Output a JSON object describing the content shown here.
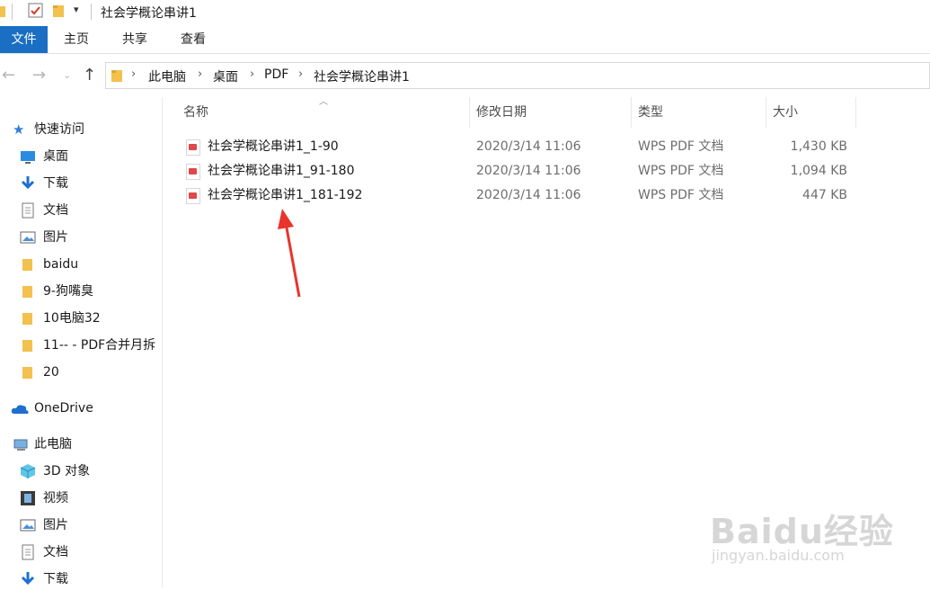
{
  "window": {
    "title": "社会学概论串讲1"
  },
  "ribbon": {
    "tabs": [
      "文件",
      "主页",
      "共享",
      "查看"
    ]
  },
  "address": {
    "crumbs": [
      "此电脑",
      "桌面",
      "PDF",
      "社会学概论串讲1"
    ]
  },
  "nav": {
    "quick_access": "快速访问",
    "quick_items": [
      "桌面",
      "下载",
      "文档",
      "图片",
      "baidu",
      "9-狗嘴臭",
      "10电脑32",
      "11-- - PDF合并月拆",
      "20"
    ],
    "onedrive": "OneDrive",
    "this_pc": "此电脑",
    "pc_items": [
      "3D 对象",
      "视频",
      "图片",
      "文档",
      "下载"
    ]
  },
  "columns": {
    "name": "名称",
    "modified": "修改日期",
    "type": "类型",
    "size": "大小"
  },
  "files": [
    {
      "name": "社会学概论串讲1_1-90",
      "modified": "2020/3/14 11:06",
      "type": "WPS PDF 文档",
      "size": "1,430 KB"
    },
    {
      "name": "社会学概论串讲1_91-180",
      "modified": "2020/3/14 11:06",
      "type": "WPS PDF 文档",
      "size": "1,094 KB"
    },
    {
      "name": "社会学概论串讲1_181-192",
      "modified": "2020/3/14 11:06",
      "type": "WPS PDF 文档",
      "size": "447 KB"
    }
  ],
  "watermark": {
    "brand": "Baidu经验",
    "url": "jingyan.baidu.com"
  },
  "colors": {
    "accent": "#1a6fc4",
    "arrow": "#e8342c",
    "folder": "#f2c14e"
  }
}
